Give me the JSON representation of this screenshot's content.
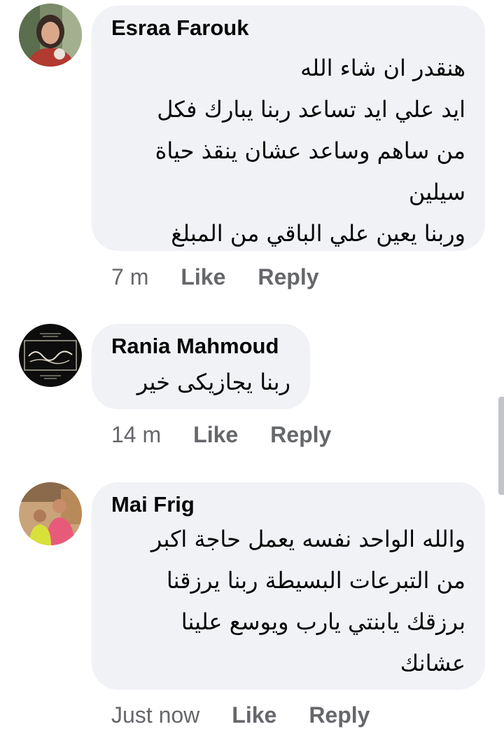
{
  "comments": [
    {
      "author": "Esraa Farouk",
      "lines": [
        "هنقدر ان شاء الله",
        "ايد علي ايد تساعد ربنا يبارك فكل",
        "من ساهم وساعد عشان ينقذ حياة",
        "سيلين",
        "وربنا يعين علي الباقي من المبلغ"
      ],
      "time": "7 m",
      "like": "Like",
      "reply": "Reply"
    },
    {
      "author": "Rania Mahmoud",
      "lines": [
        "ربنا يجازيكى خير"
      ],
      "time": "14 m",
      "like": "Like",
      "reply": "Reply"
    },
    {
      "author": "Mai Frig",
      "lines": [
        "والله الواحد نفسه يعمل حاجة اكبر",
        "من  التبرعات البسيطة ربنا يرزقنا",
        "برزقك يابنتي يارب ويوسع علينا",
        "عشانك"
      ],
      "time": "Just now",
      "like": "Like",
      "reply": "Reply"
    }
  ],
  "colors": {
    "bubble": "#f0f2f5",
    "meta": "#65676b",
    "text": "#050505"
  }
}
